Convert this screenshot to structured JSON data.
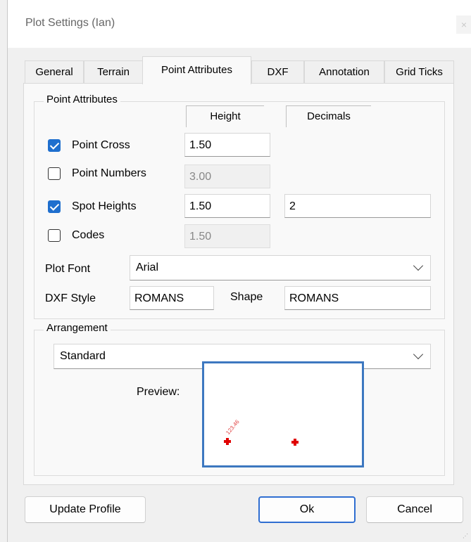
{
  "window": {
    "title": "Plot Settings  (Ian)",
    "close_glyph": "×"
  },
  "tabs": [
    "General",
    "Terrain",
    "Point Attributes",
    "DXF",
    "Annotation",
    "Grid Ticks"
  ],
  "point_attributes": {
    "legend": "Point Attributes",
    "height_header": "Height",
    "decimals_header": "Decimals",
    "rows": [
      {
        "label": "Point Cross",
        "checked": true,
        "height": "1.50",
        "height_enabled": true,
        "decimals": ""
      },
      {
        "label": "Point Numbers",
        "checked": false,
        "height": "3.00",
        "height_enabled": false,
        "decimals": ""
      },
      {
        "label": "Spot Heights",
        "checked": true,
        "height": "1.50",
        "height_enabled": true,
        "decimals": "2"
      },
      {
        "label": "Codes",
        "checked": false,
        "height": "1.50",
        "height_enabled": false,
        "decimals": ""
      }
    ],
    "plot_font_label": "Plot Font",
    "plot_font_value": "Arial",
    "dxf_style_label": "DXF Style",
    "dxf_style_value": "ROMANS",
    "shape_label": "Shape",
    "shape_value": "ROMANS"
  },
  "arrangement": {
    "legend": "Arrangement",
    "value": "Standard",
    "preview_label": "Preview:",
    "preview_annotation": "123.46"
  },
  "buttons": {
    "update_profile": "Update Profile",
    "ok": "Ok",
    "cancel": "Cancel"
  },
  "colors": {
    "accent": "#1f6fce",
    "marker": "#e00000",
    "preview_border": "#3d78c0"
  }
}
